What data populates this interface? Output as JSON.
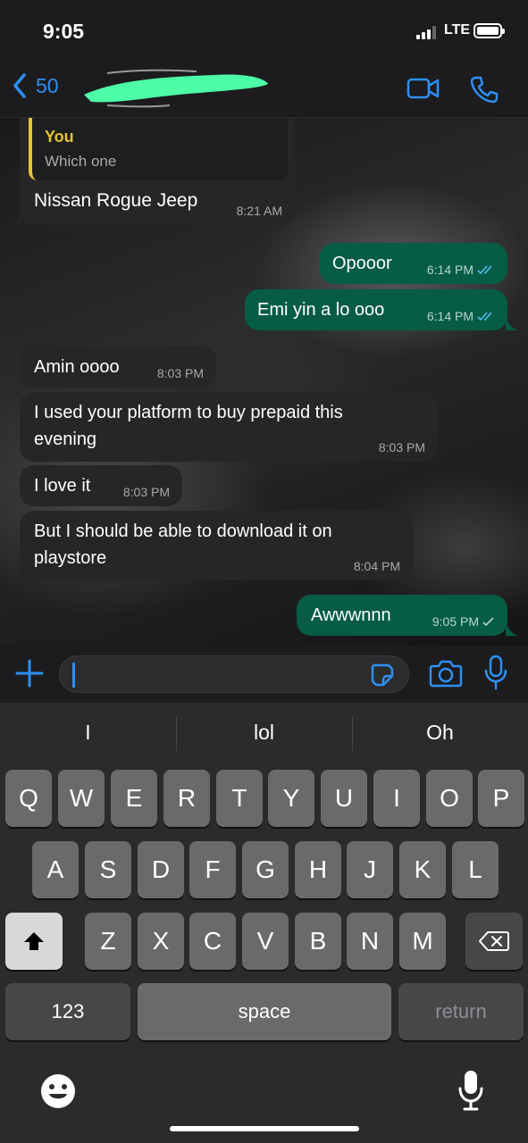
{
  "status_bar": {
    "time": "9:05",
    "network": "LTE"
  },
  "header": {
    "back_count": "50"
  },
  "messages": [
    {
      "quote_sender": "You",
      "quote_text": "Which one",
      "text": "Nissan Rogue Jeep",
      "time": "8:21 AM",
      "direction": "in"
    },
    {
      "text": "Opooor",
      "time": "6:14 PM",
      "direction": "out",
      "status": "read"
    },
    {
      "text": "Emi yin a lo ooo",
      "time": "6:14 PM",
      "direction": "out",
      "status": "read"
    },
    {
      "text": "Amin oooo",
      "time": "8:03 PM",
      "direction": "in"
    },
    {
      "text_line1": "I used your platform to buy prepaid this",
      "text_line2": "evening",
      "time": "8:03 PM",
      "direction": "in"
    },
    {
      "text": "I love it",
      "time": "8:03 PM",
      "direction": "in"
    },
    {
      "text_line1": "But I should be able to download it on",
      "text_line2": "playstore",
      "time": "8:04 PM",
      "direction": "in"
    },
    {
      "text": "Awwwnnn",
      "time": "9:05 PM",
      "direction": "out",
      "status": "sent"
    }
  ],
  "input": {
    "value": ""
  },
  "keyboard": {
    "suggestions": [
      "I",
      "lol",
      "Oh"
    ],
    "row1": [
      "Q",
      "W",
      "E",
      "R",
      "T",
      "Y",
      "U",
      "I",
      "O",
      "P"
    ],
    "row2": [
      "A",
      "S",
      "D",
      "F",
      "G",
      "H",
      "J",
      "K",
      "L"
    ],
    "row3": [
      "Z",
      "X",
      "C",
      "V",
      "B",
      "N",
      "M"
    ],
    "numbers_label": "123",
    "space_label": "space",
    "return_label": "return"
  },
  "colors": {
    "outgoing_bubble": "#065c45",
    "incoming_bubble": "#262628",
    "accent": "#2f8ff2",
    "quote_accent": "#e7c32f",
    "read_tick": "#53bdeb",
    "redaction": "#4dfca6"
  },
  "icons": [
    "back-chevron-icon",
    "video-call-icon",
    "phone-call-icon",
    "plus-icon",
    "sticker-icon",
    "camera-icon",
    "microphone-icon",
    "shift-icon",
    "backspace-icon",
    "emoji-icon",
    "dictation-icon"
  ]
}
